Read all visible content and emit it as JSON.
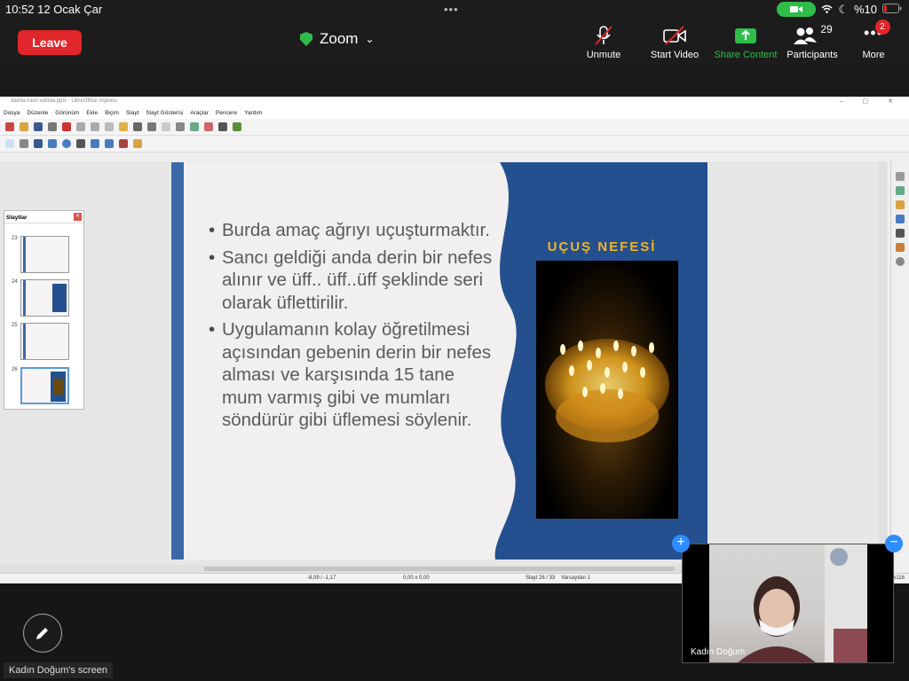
{
  "status_bar": {
    "time": "10:52",
    "date": "12 Ocak Çar",
    "battery": "%10"
  },
  "zoom": {
    "leave_label": "Leave",
    "meeting_title": "Zoom",
    "unmute_label": "Unmute",
    "start_video_label": "Start Video",
    "share_content_label": "Share Content",
    "participants_label": "Participants",
    "participants_count": "29",
    "more_label": "More",
    "more_badge": "2",
    "screen_label": "Kadın Doğum's screen",
    "video_name": "Kadın Doğum"
  },
  "colors": {
    "leave": "#e0262a",
    "share_green": "#2fbd4a",
    "slide_blue": "#24508f",
    "slide_bar": "#3b69a8",
    "title_gold": "#f0b429"
  },
  "libreoffice": {
    "window_title": "damla nasıl vidoda.pptx - LibreOffice Impress",
    "menu": [
      "Dosya",
      "Düzenle",
      "Görünüm",
      "Ekle",
      "Biçim",
      "Slayt",
      "Slayt Gösterisi",
      "Araçlar",
      "Pencere",
      "Yardım"
    ],
    "slide_pane_title": "Slaytlar",
    "thumbs": [
      "23",
      "24",
      "25",
      "26"
    ],
    "status": {
      "position": "-8,09 / -1,17",
      "size": "0,00 x 0,00",
      "slide": "Slayt 26 / 33",
      "layout": "Varsayılan 1",
      "zoom": "%118"
    }
  },
  "slide": {
    "title": "UÇUŞ NEFESİ",
    "bullets": [
      "Burda amaç ağrıyı uçuşturmaktır.",
      "Sancı geldiği anda derin bir nefes alınır ve üff.. üff..üff şeklinde seri olarak üflettirilir.",
      "Uygulamanın kolay öğretilmesi açısından gebenin derin bir nefes alması ve karşısında 15 tane mum varmış gibi ve mumları söndürür gibi üflemesi söylenir."
    ]
  }
}
